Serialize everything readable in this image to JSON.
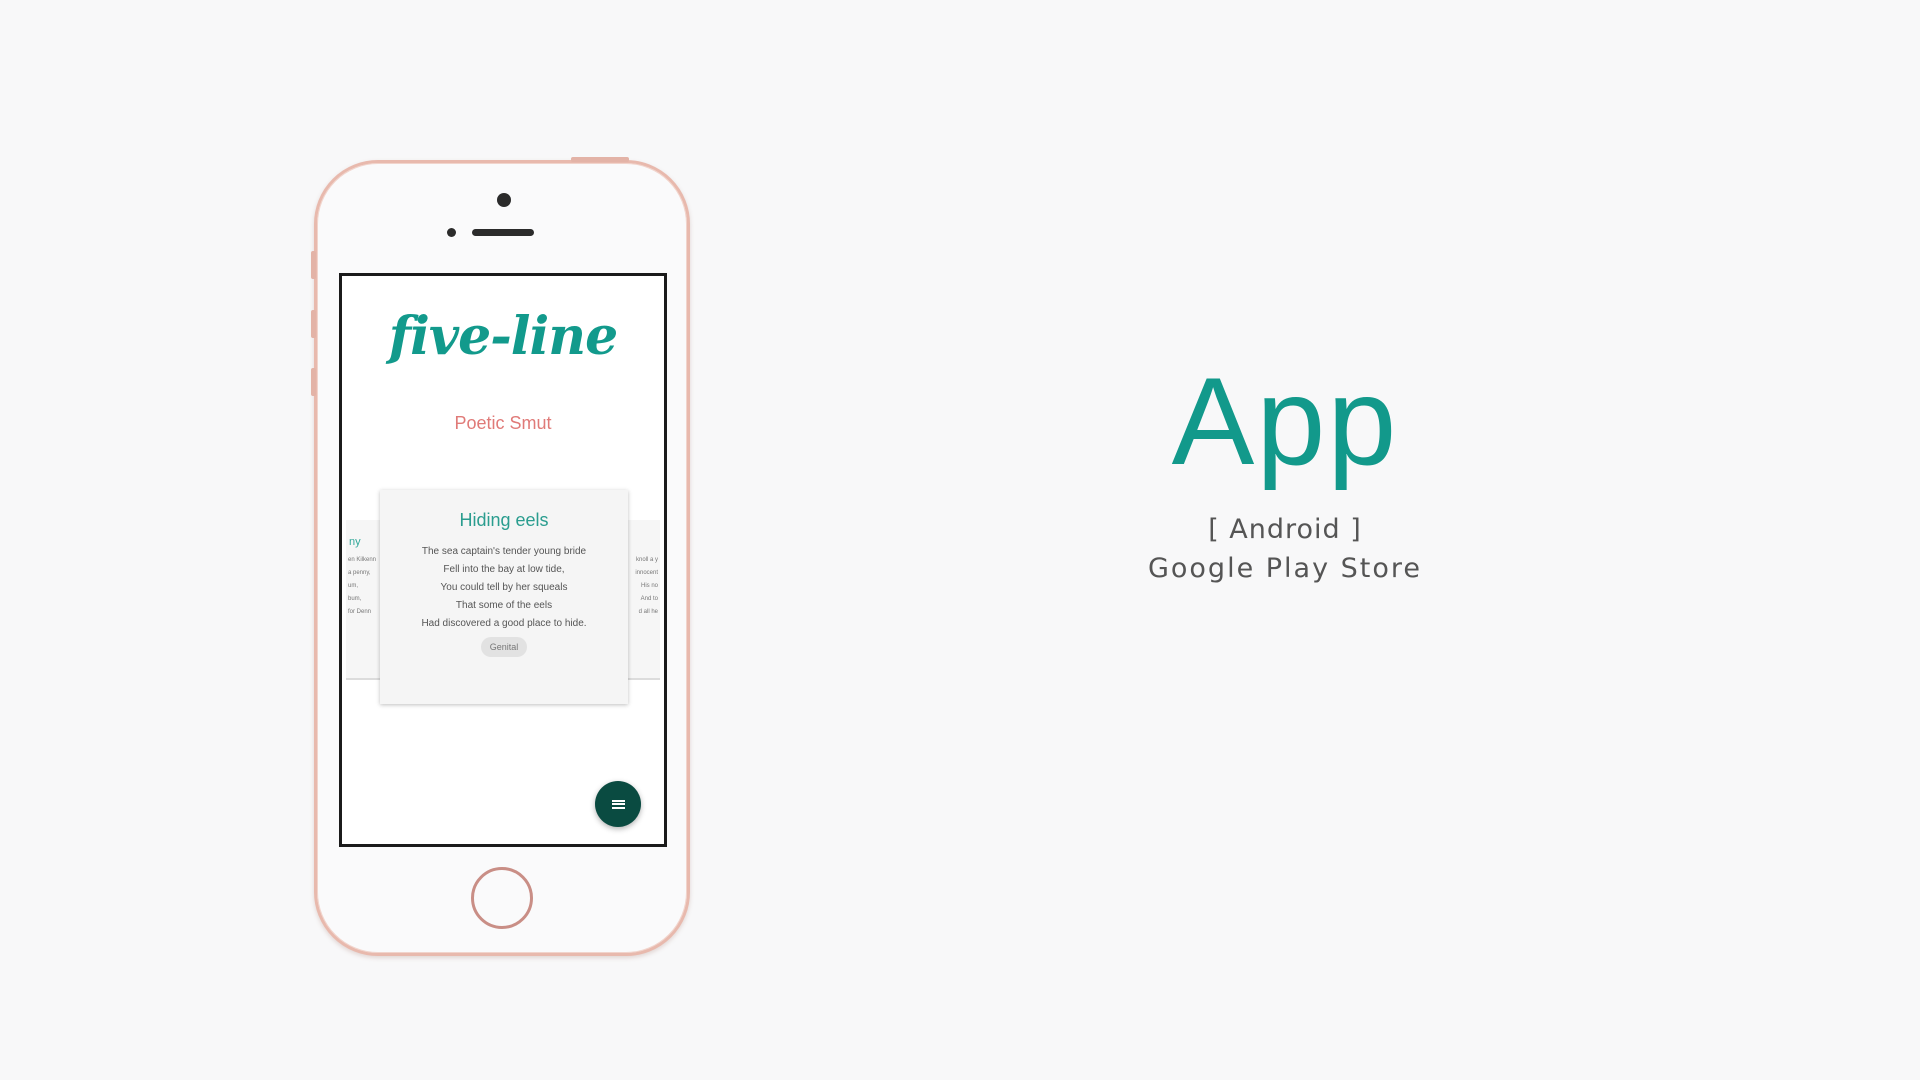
{
  "colors": {
    "background": "#f8f8f9",
    "accent": "#12998b",
    "tagline": "#e07a78",
    "phone_frame": "#e8b9ad",
    "fab": "#0a4b41"
  },
  "app_screen": {
    "logo_text": "five-line",
    "tagline": "Poetic Smut",
    "poem": {
      "title": "Hiding eels",
      "lines": [
        "The sea captain's tender young bride",
        "Fell into the bay at low tide,",
        "You could tell by her squeals",
        "That some of the eels",
        "Had discovered a good place to hide."
      ],
      "tag": "Genital"
    },
    "left_card": {
      "title": "ny",
      "lines": [
        "en Kilkenn",
        "a penny,",
        "um,",
        "bum,",
        "for Denn"
      ]
    },
    "right_card": {
      "lines": [
        "knoll a y",
        "innocent",
        "His no",
        "And to",
        "d all he"
      ]
    },
    "fab_icon": "menu-icon"
  },
  "promo": {
    "title": "App",
    "platform": "[ Android ]",
    "store": "Google Play Store"
  }
}
